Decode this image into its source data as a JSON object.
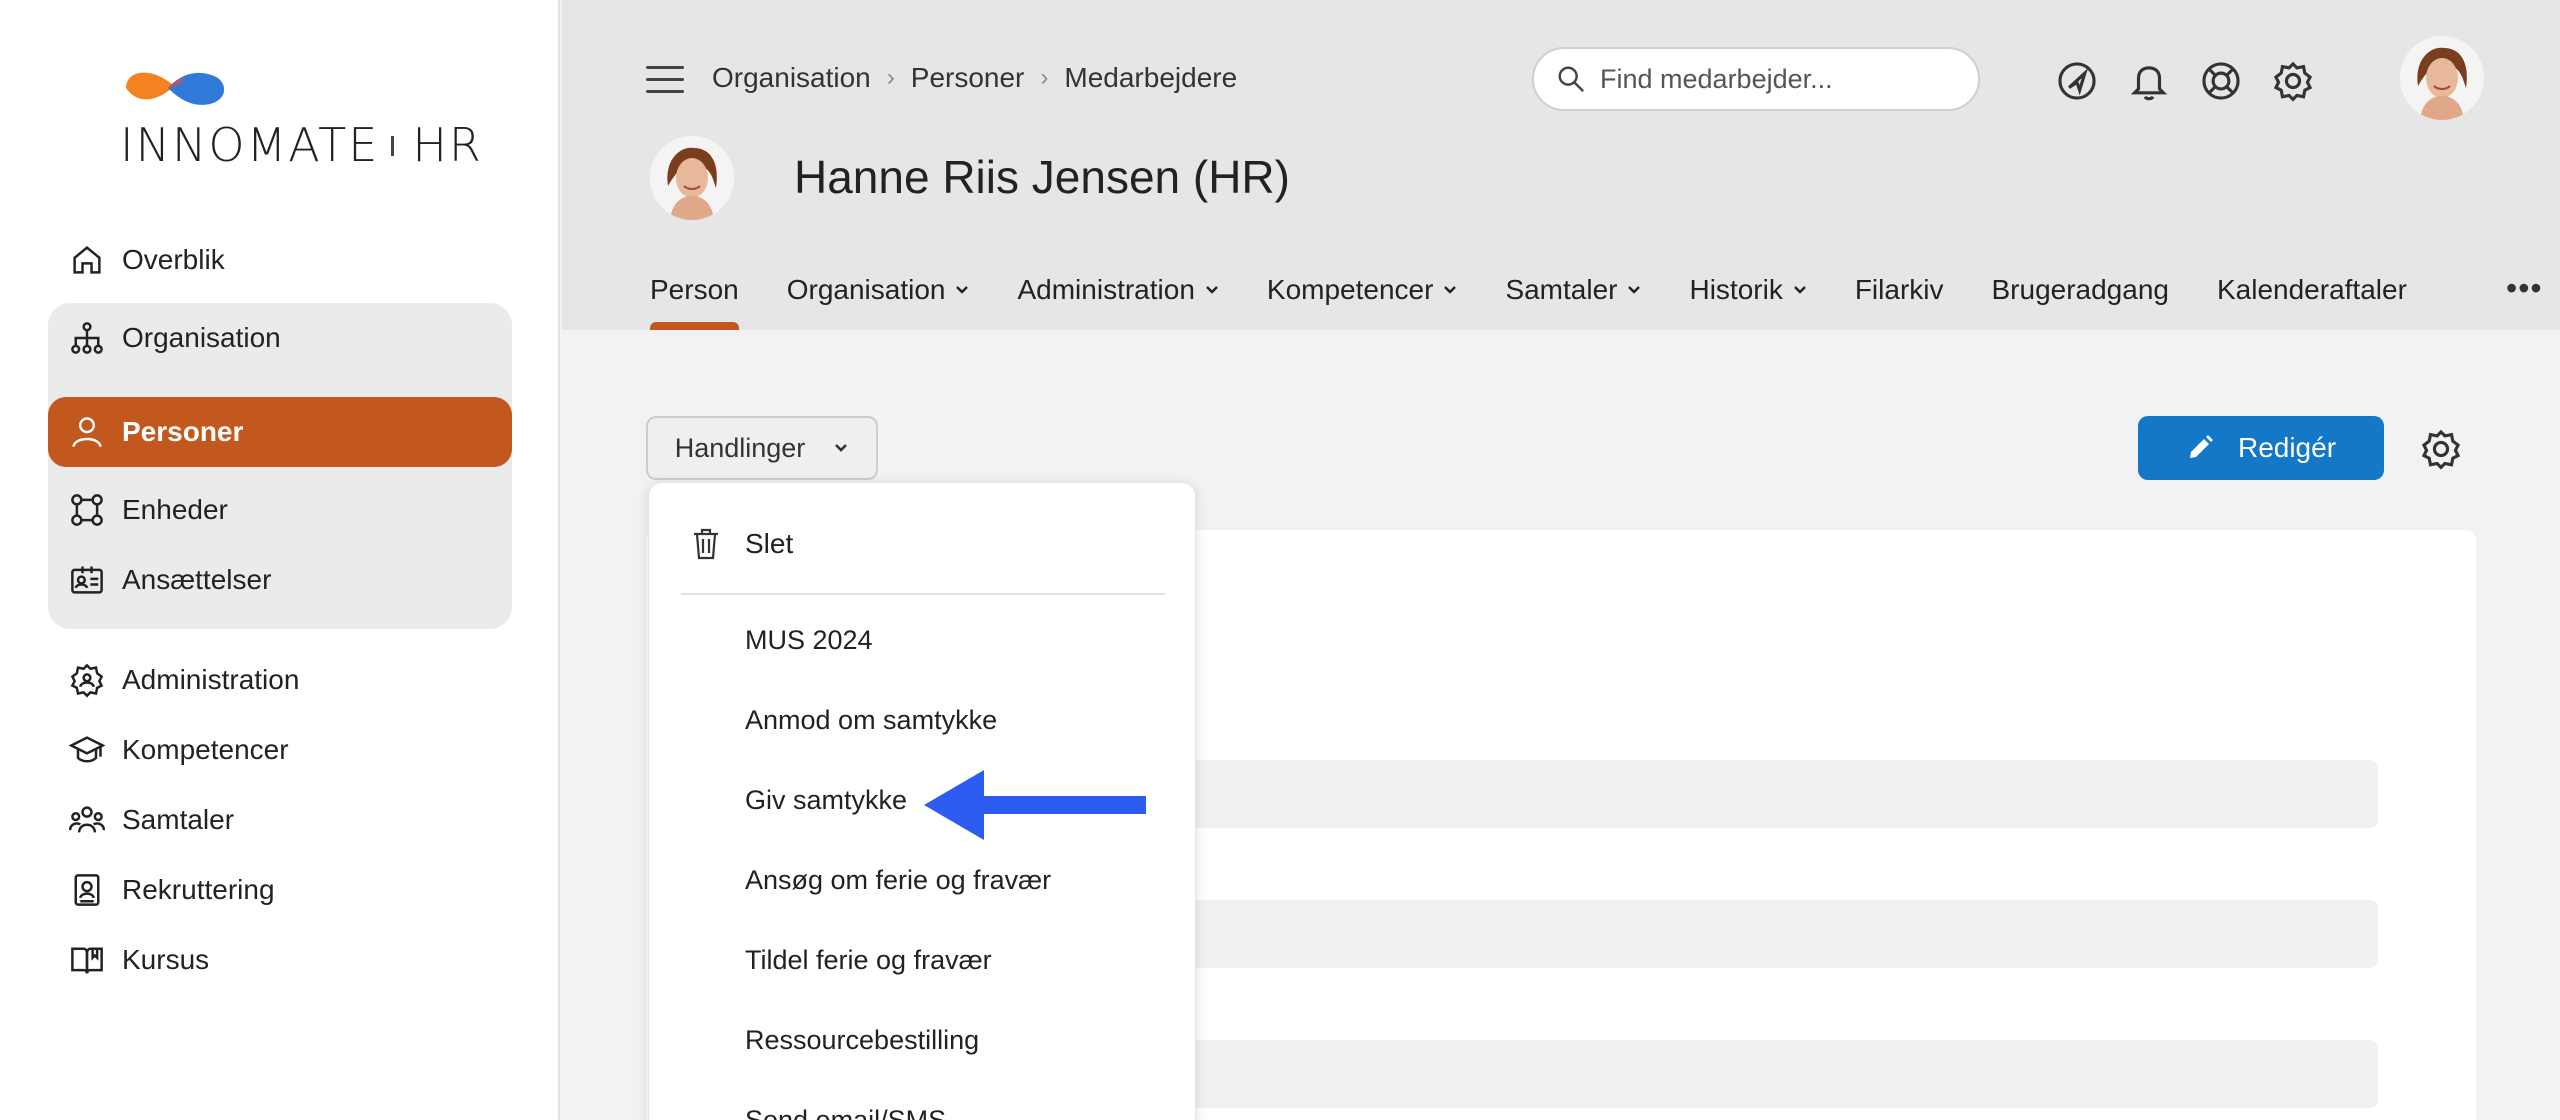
{
  "brand": {
    "name_left": "INNOMATE",
    "name_right": "HR"
  },
  "sidebar": {
    "items": [
      {
        "label": "Overblik",
        "icon": "home-icon"
      },
      {
        "label": "Organisation",
        "icon": "org-chart-icon"
      },
      {
        "label": "Personer",
        "icon": "person-icon"
      },
      {
        "label": "Enheder",
        "icon": "units-icon"
      },
      {
        "label": "Ansættelser",
        "icon": "id-card-icon"
      },
      {
        "label": "Administration",
        "icon": "gear-user-icon"
      },
      {
        "label": "Kompetencer",
        "icon": "graduation-cap-icon"
      },
      {
        "label": "Samtaler",
        "icon": "group-icon"
      },
      {
        "label": "Rekruttering",
        "icon": "badge-icon"
      },
      {
        "label": "Kursus",
        "icon": "book-icon"
      }
    ]
  },
  "header": {
    "breadcrumb": [
      "Organisation",
      "Personer",
      "Medarbejdere"
    ],
    "search_placeholder": "Find medarbejder...",
    "person_name": "Hanne Riis Jensen (HR)",
    "tabs": [
      {
        "label": "Person",
        "dropdown": false
      },
      {
        "label": "Organisation",
        "dropdown": true
      },
      {
        "label": "Administration",
        "dropdown": true
      },
      {
        "label": "Kompetencer",
        "dropdown": true
      },
      {
        "label": "Samtaler",
        "dropdown": true
      },
      {
        "label": "Historik",
        "dropdown": true
      },
      {
        "label": "Filarkiv",
        "dropdown": false
      },
      {
        "label": "Brugeradgang",
        "dropdown": false
      },
      {
        "label": "Kalenderaftaler",
        "dropdown": false
      }
    ],
    "more_label": "•••"
  },
  "toolbar": {
    "actions_label": "Handlinger",
    "edit_label": "Redigér"
  },
  "menu": {
    "delete_label": "Slet",
    "items": [
      "MUS 2024",
      "Anmod om samtykke",
      "Giv samtykke",
      "Ansøg om ferie og fravær",
      "Tildel ferie og fravær",
      "Ressourcebestilling",
      "Send email/SMS"
    ]
  },
  "colors": {
    "accent": "#c2581e",
    "primary_button": "#1478c8",
    "arrow": "#2f5cf0",
    "logo_orange": "#f58220",
    "logo_blue": "#2f7ad9"
  }
}
